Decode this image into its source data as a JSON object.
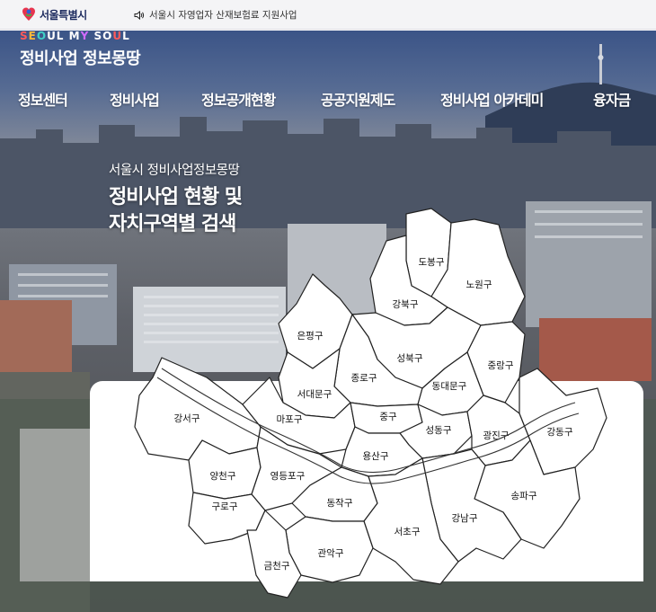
{
  "topbar": {
    "logo_text": "서울특별시",
    "notice_text": "서울시 자영업자 산재보험료 지원사업"
  },
  "brand": {
    "slogan": "SEOUL MY SOUL",
    "title": "정비사업 정보몽땅"
  },
  "gnb": {
    "items": [
      "정보센터",
      "정비사업",
      "정보공개현황",
      "공공지원제도",
      "정비사업 아카데미",
      "융자금"
    ]
  },
  "headline": {
    "sub": "서울시 정비사업정보몽땅",
    "line1": "정비사업 현황 및",
    "line2": "자치구역별 검색"
  },
  "map": {
    "districts": [
      "도봉구",
      "노원구",
      "강북구",
      "은평구",
      "성북구",
      "중랑구",
      "종로구",
      "동대문구",
      "서대문구",
      "강서구",
      "마포구",
      "중구",
      "성동구",
      "광진구",
      "강동구",
      "용산구",
      "양천구",
      "영등포구",
      "동작구",
      "구로구",
      "송파구",
      "강남구",
      "서초구",
      "관악구",
      "금천구"
    ]
  },
  "colors": {
    "topbar_bg": "#f4f4f6",
    "brand_navy": "#1c2a5e",
    "map_fill": "#ffffff",
    "map_stroke": "#222222"
  }
}
